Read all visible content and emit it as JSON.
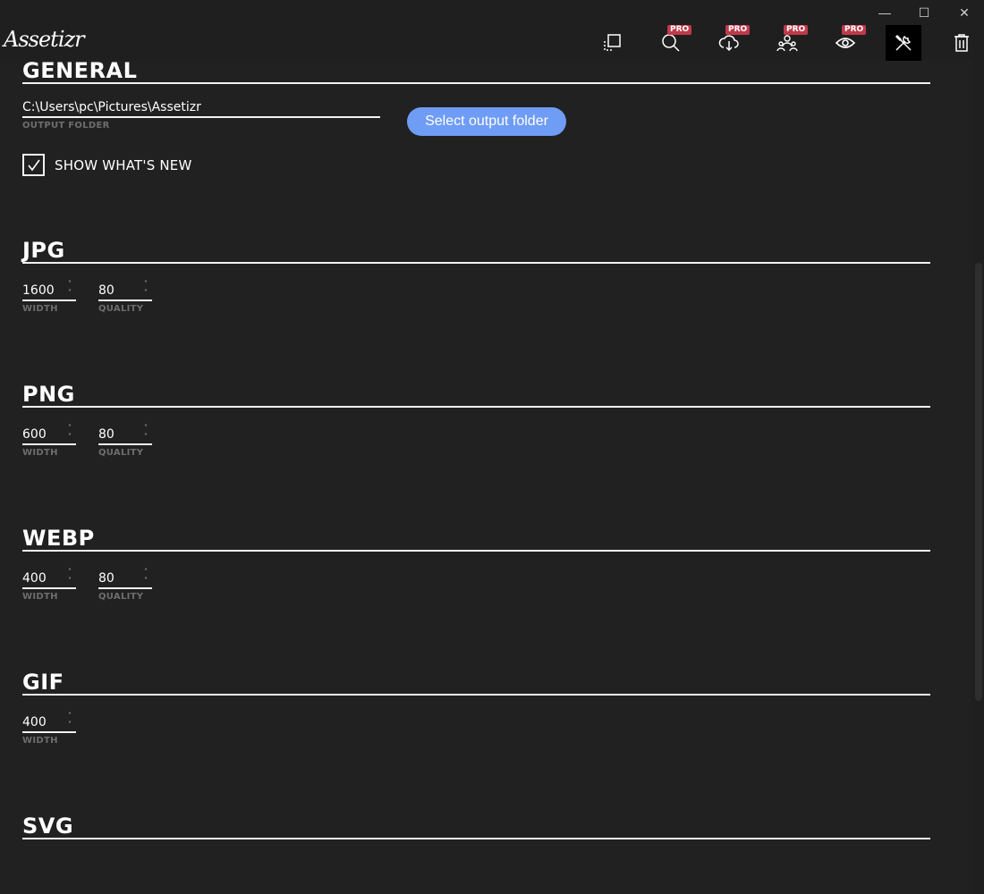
{
  "app": {
    "logo_text": "Assetizr"
  },
  "window_controls": {
    "minimize": "—",
    "maximize": "☐",
    "close": "✕"
  },
  "toolbar": {
    "pro_label": "PRO",
    "tools": [
      {
        "name": "resize",
        "icon": "resize-icon",
        "pro": false
      },
      {
        "name": "search",
        "icon": "search-icon",
        "pro": true
      },
      {
        "name": "download",
        "icon": "cloud-download-icon",
        "pro": true
      },
      {
        "name": "users",
        "icon": "users-icon",
        "pro": true
      },
      {
        "name": "preview",
        "icon": "eye-icon",
        "pro": true
      },
      {
        "name": "settings",
        "icon": "tools-icon",
        "pro": false,
        "active": true
      },
      {
        "name": "trash",
        "icon": "trash-icon",
        "pro": false
      }
    ]
  },
  "general": {
    "title": "GENERAL",
    "output_folder": {
      "value": "C:\\Users\\pc\\Pictures\\Assetizr",
      "label": "OUTPUT FOLDER"
    },
    "select_button": "Select output folder",
    "show_whats_new": {
      "label": "SHOW WHAT'S NEW",
      "checked": true
    }
  },
  "jpg": {
    "title": "JPG",
    "width": {
      "value": "1600",
      "label": "WIDTH"
    },
    "quality": {
      "value": "80",
      "label": "QUALITY"
    }
  },
  "png": {
    "title": "PNG",
    "width": {
      "value": "600",
      "label": "WIDTH"
    },
    "quality": {
      "value": "80",
      "label": "QUALITY"
    }
  },
  "webp": {
    "title": "WEBP",
    "width": {
      "value": "400",
      "label": "WIDTH"
    },
    "quality": {
      "value": "80",
      "label": "QUALITY"
    }
  },
  "gif": {
    "title": "GIF",
    "width": {
      "value": "400",
      "label": "WIDTH"
    }
  },
  "svg": {
    "title": "SVG"
  },
  "colors": {
    "accent": "#6f9cf5",
    "pro_badge": "#c0394a",
    "background": "#212121"
  }
}
